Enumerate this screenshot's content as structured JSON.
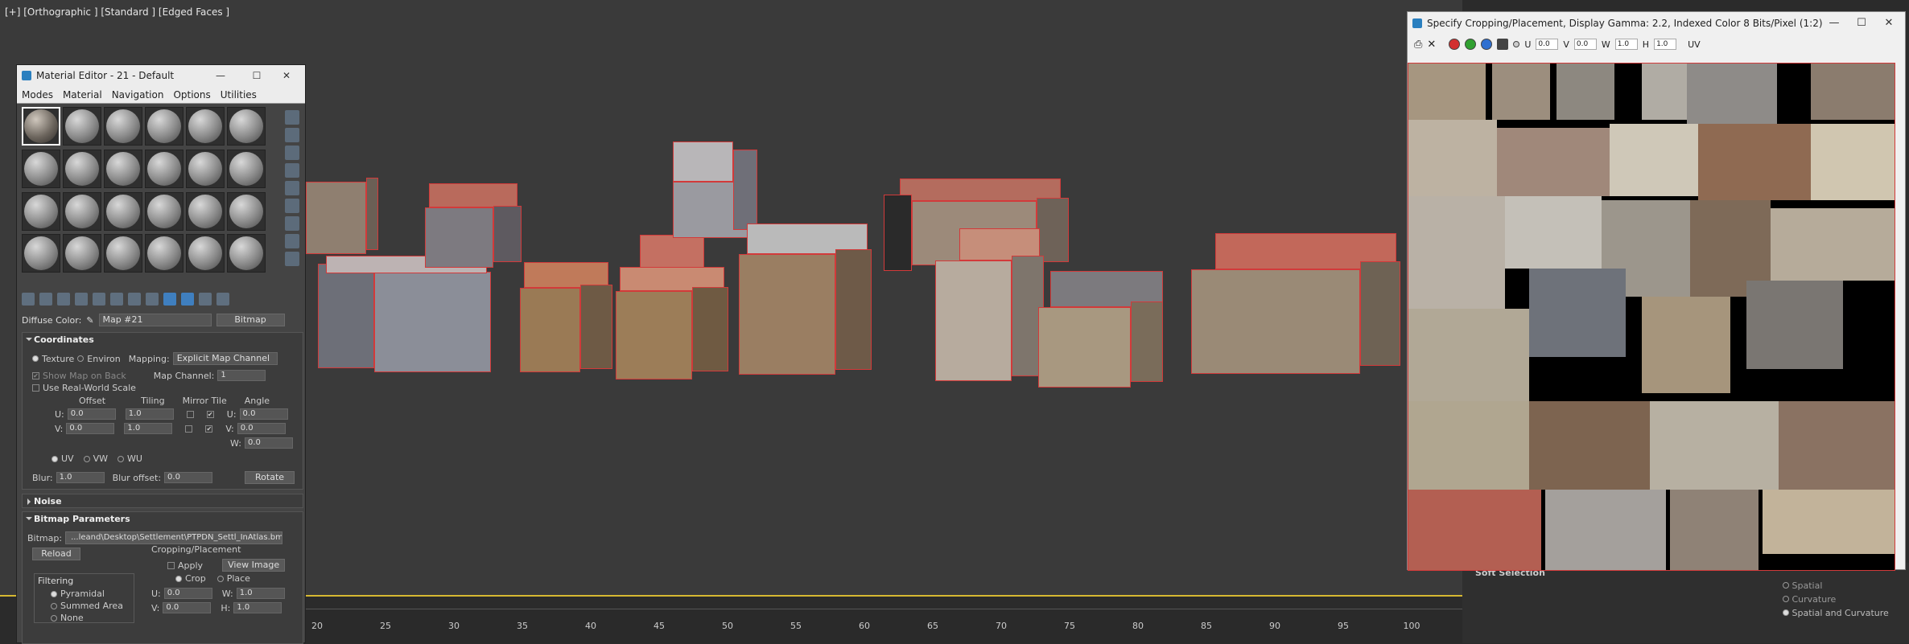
{
  "viewport": {
    "label": "[+] [Orthographic ] [Standard ] [Edged Faces ]"
  },
  "material_editor": {
    "title": "Material Editor - 21 - Default",
    "menu": [
      "Modes",
      "Material",
      "Navigation",
      "Options",
      "Utilities"
    ],
    "diffuse_label": "Diffuse Color:",
    "map_name": "Map #21",
    "map_type": "Bitmap",
    "coordinates": {
      "header": "Coordinates",
      "texture": "Texture",
      "environ": "Environ",
      "mapping_label": "Mapping:",
      "mapping_value": "Explicit Map Channel",
      "show_map_on_back": "Show Map on Back",
      "map_channel_label": "Map Channel:",
      "map_channel_value": "1",
      "use_real_world": "Use Real-World Scale",
      "offset": "Offset",
      "tiling": "Tiling",
      "mirror_tile": "Mirror Tile",
      "angle": "Angle",
      "u_label": "U:",
      "v_label": "V:",
      "w_label": "W:",
      "u_offset": "0.0",
      "v_offset": "0.0",
      "u_tiling": "1.0",
      "v_tiling": "1.0",
      "u_angle": "0.0",
      "v_angle": "0.0",
      "w_angle": "0.0",
      "uv": "UV",
      "vw": "VW",
      "wu": "WU",
      "blur_label": "Blur:",
      "blur_value": "1.0",
      "blur_offset_label": "Blur offset:",
      "blur_offset_value": "0.0",
      "rotate": "Rotate"
    },
    "noise": {
      "header": "Noise"
    },
    "bitmap_params": {
      "header": "Bitmap Parameters",
      "bitmap_label": "Bitmap:",
      "bitmap_path": "...leand\\Desktop\\Settlement\\PTPDN_Settl_InAtlas.bmp",
      "reload": "Reload",
      "cropping_label": "Cropping/Placement",
      "apply": "Apply",
      "view_image": "View Image",
      "crop": "Crop",
      "place": "Place",
      "filtering": "Filtering",
      "pyramidal": "Pyramidal",
      "summed_area": "Summed Area",
      "none": "None",
      "u_label": "U:",
      "v_label": "V:",
      "w_label": "W:",
      "h_label": "H:",
      "u_value": "0.0",
      "v_value": "0.0",
      "w_value": "1.0",
      "h_value": "1.0"
    }
  },
  "viewer": {
    "title": "Specify Cropping/Placement, Display Gamma: 2.2, Indexed Color 8 Bits/Pixel (1:2)",
    "u_label": "U",
    "v_label": "V",
    "w_label": "W",
    "h_label": "H",
    "uv_label": "UV",
    "u": "0.0",
    "v": "0.0",
    "w": "1.0",
    "h": "1.0",
    "colors": {
      "red": "#d23030",
      "green": "#30a030",
      "blue": "#3070d0"
    }
  },
  "command_panel": {
    "soft_selection": "Soft Selection",
    "spatial": "Spatial",
    "curvature": "Curvature",
    "spatial_curvature": "Spatial and Curvature"
  },
  "timeline": {
    "ticks": [
      "20",
      "25",
      "30",
      "35",
      "40",
      "45",
      "50",
      "55",
      "60",
      "65",
      "70",
      "75",
      "80",
      "85",
      "90",
      "95",
      "100"
    ]
  }
}
